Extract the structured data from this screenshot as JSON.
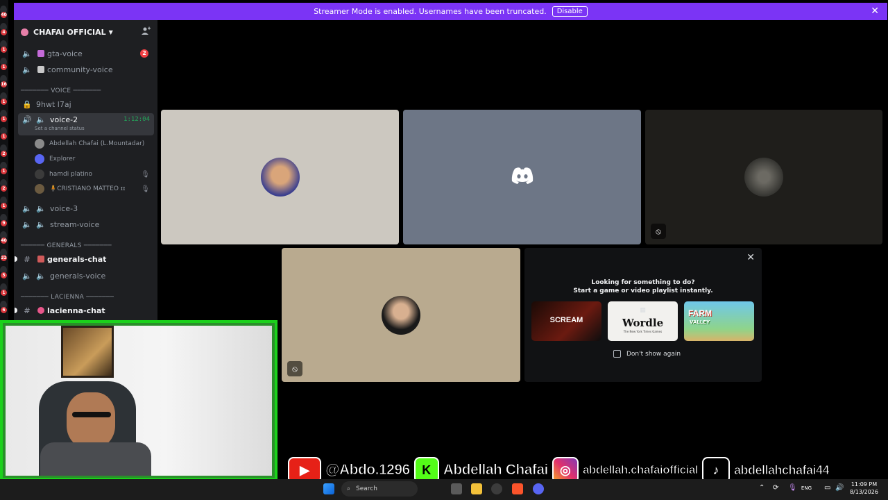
{
  "banner": {
    "message": "Streamer Mode is enabled. Usernames have been truncated.",
    "button": "Disable",
    "accent": "#7b34f5"
  },
  "guild_rail": {
    "badges": [
      "40",
      "4",
      "1",
      "1",
      "16",
      "1",
      "1",
      "1",
      "2",
      "1",
      "2",
      "1",
      "9",
      "40",
      "22",
      "5",
      "1",
      "6"
    ]
  },
  "sidebar": {
    "server_name": "CHAFAI OFFICIAL",
    "channels": [
      {
        "name": "gta-voice",
        "badge": "2"
      },
      {
        "name": "community-voice"
      },
      {
        "category": "─────── VOICE ───────"
      },
      {
        "name": "9hwt l7aj"
      },
      {
        "name": "voice-2",
        "timer": "1:12:04",
        "status": "Set a channel status"
      },
      {
        "name": "voice-3"
      },
      {
        "name": "stream-voice"
      },
      {
        "category": "────── GENERALS ───────"
      },
      {
        "name": "generals-chat"
      },
      {
        "name": "generals-voice"
      },
      {
        "category": "─────── LACIENNA ───────"
      },
      {
        "name": "lacienna-chat"
      }
    ],
    "voice_users": [
      {
        "name": "Abdellah Chafai (L.Mountadar)"
      },
      {
        "name": "Explorer"
      },
      {
        "name": "hamdi platino"
      },
      {
        "name": "🧍CRISTIANO MATTEO ɪɪ"
      }
    ]
  },
  "activity": {
    "title_line1": "Looking for something to do?",
    "title_line2": "Start a game or video playlist instantly.",
    "games": [
      "SCREAM",
      "Wordle",
      "FARM"
    ],
    "game_sub": [
      "",
      "The New York Times Games",
      "VALLEY"
    ],
    "dont_show": "Don't show again"
  },
  "socials": {
    "youtube": "@Abdo.1296",
    "kick": "Abdellah Chafai",
    "instagram": "abdellah.chafaiofficial",
    "tiktok": "abdellahchafai44",
    "kick_icon": "K"
  },
  "taskbar": {
    "search": "Search",
    "lang": "ENG",
    "time": "11:09 PM",
    "date": "8/13/2026"
  }
}
